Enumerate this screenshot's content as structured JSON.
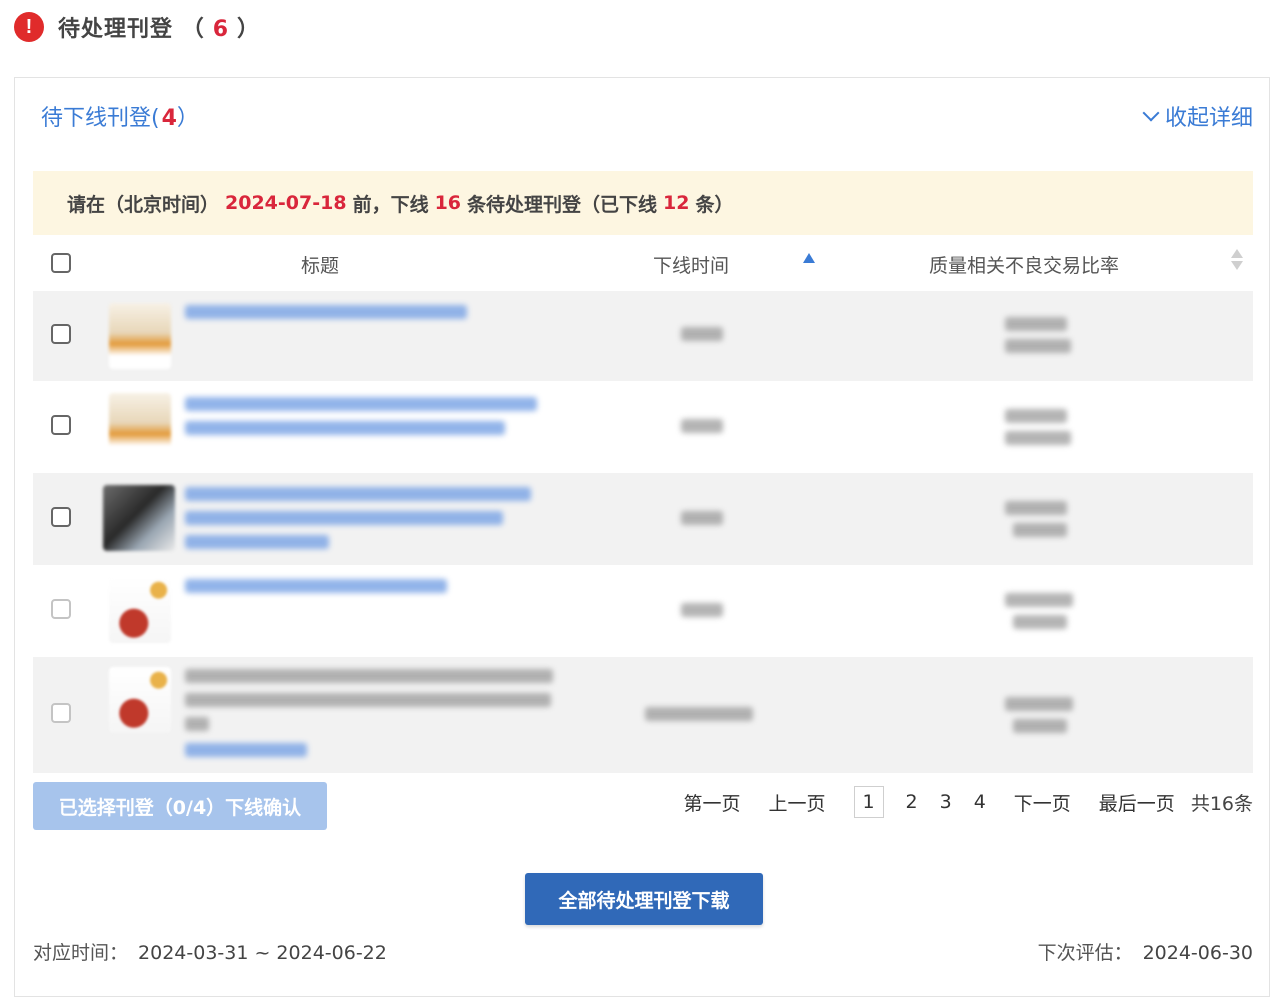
{
  "header": {
    "title": "待处理刊登",
    "count": "6",
    "paren_open": "（",
    "paren_close": "）"
  },
  "section": {
    "title": "待下线刊登(",
    "count": "4",
    "close": "）",
    "collapse_label": "收起详细"
  },
  "notice": {
    "prefix": "请在（北京时间）",
    "date": "2024-07-18",
    "mid1": "前，下线",
    "count": "16",
    "mid2": "条待处理刊登（已下线",
    "done": "12",
    "suffix": "条）"
  },
  "table": {
    "columns": [
      "标题",
      "下线时间",
      "质量相关不良交易比率"
    ]
  },
  "selection_button_label": "已选择刊登（0/4）下线确认",
  "pagination": {
    "first": "第一页",
    "prev": "上一页",
    "current": "1",
    "pages": [
      "2",
      "3",
      "4"
    ],
    "next": "下一页",
    "last": "最后一页",
    "total": "共16条"
  },
  "download_button_label": "全部待处理刊登下载",
  "footer": {
    "period_label": "对应时间：",
    "period_value": "2024-03-31 ~ 2024-06-22",
    "next_eval_label": "下次评估：",
    "next_eval_value": "2024-06-30"
  }
}
